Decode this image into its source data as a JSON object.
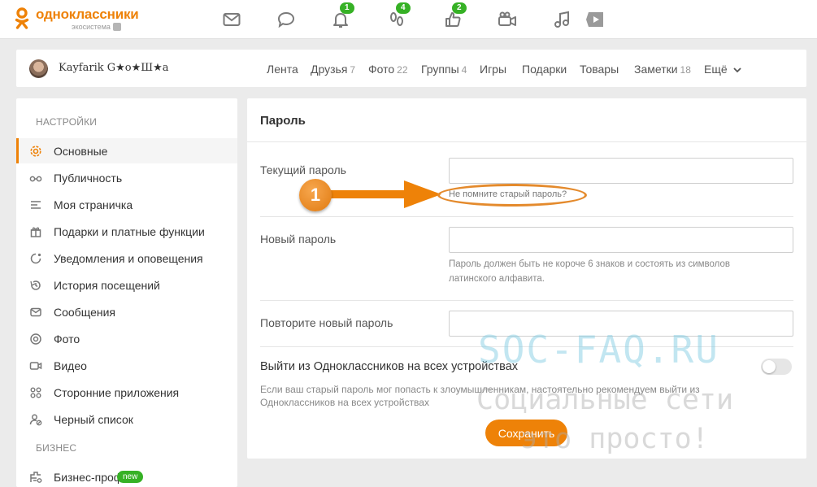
{
  "app": {
    "logo_title": "одноклассники",
    "logo_subtitle": "экосистема",
    "accent_color": "#ee8208",
    "badge_color": "#36b125"
  },
  "topbar": {
    "icons": [
      {
        "name": "mail-icon",
        "badge": ""
      },
      {
        "name": "chat-icon",
        "badge": ""
      },
      {
        "name": "bell-icon",
        "badge": "1"
      },
      {
        "name": "guests-icon",
        "badge": "4"
      },
      {
        "name": "like-icon",
        "badge": "2"
      },
      {
        "name": "video-camera-icon",
        "badge": ""
      },
      {
        "name": "music-icon",
        "badge": ""
      },
      {
        "name": "play-icon",
        "badge": ""
      }
    ]
  },
  "profile": {
    "username": "Kayfarik G★o★Ш★a"
  },
  "nav": {
    "items": [
      {
        "label": "Лента",
        "count": ""
      },
      {
        "label": "Друзья",
        "count": "7"
      },
      {
        "label": "Фото",
        "count": "22"
      },
      {
        "label": "Группы",
        "count": "4"
      },
      {
        "label": "Игры",
        "count": ""
      },
      {
        "label": "Подарки",
        "count": ""
      },
      {
        "label": "Товары",
        "count": ""
      },
      {
        "label": "Заметки",
        "count": "18"
      },
      {
        "label": "Ещё",
        "count": ""
      }
    ]
  },
  "sidebar": {
    "heading_settings": "НАСТРОЙКИ",
    "heading_business": "БИЗНЕС",
    "items": [
      {
        "label": "Основные",
        "icon": "gear-icon",
        "active": true
      },
      {
        "label": "Публичность",
        "icon": "glasses-icon",
        "active": false
      },
      {
        "label": "Моя страничка",
        "icon": "lines-icon",
        "active": false
      },
      {
        "label": "Подарки и платные функции",
        "icon": "gift-icon",
        "active": false
      },
      {
        "label": "Уведомления и оповещения",
        "icon": "notification-icon",
        "active": false
      },
      {
        "label": "История посещений",
        "icon": "history-icon",
        "active": false
      },
      {
        "label": "Сообщения",
        "icon": "message-icon",
        "active": false
      },
      {
        "label": "Фото",
        "icon": "camera-icon",
        "active": false
      },
      {
        "label": "Видео",
        "icon": "video-icon",
        "active": false
      },
      {
        "label": "Сторонние приложения",
        "icon": "apps-icon",
        "active": false
      },
      {
        "label": "Черный список",
        "icon": "blocked-user-icon",
        "active": false
      }
    ],
    "business_item": {
      "label": "Бизнес-профиль",
      "badge": "new",
      "icon": "business-icon"
    }
  },
  "main": {
    "title": "Пароль",
    "current_password_label": "Текущий пароль",
    "forgot_link": "Не помните старый пароль?",
    "new_password_label": "Новый пароль",
    "new_password_hint_1": "Пароль должен быть не короче 6 знаков и состоять из символов",
    "new_password_hint_2": "латинского алфавита.",
    "repeat_password_label": "Повторите новый пароль",
    "logout_title": "Выйти из Одноклассников на всех устройствах",
    "logout_desc_1": "Если ваш старый пароль мог попасть к злоумышленникам, настоятельно рекомендуем выйти из",
    "logout_desc_2": "Одноклассников на всех устройствах",
    "logout_toggle_on": false,
    "save_button": "Сохранить"
  },
  "annotation": {
    "number": "1"
  },
  "watermark": {
    "line1": "SOC-FAQ.RU",
    "line2": "Социальные сети",
    "line3": "это просто!"
  }
}
